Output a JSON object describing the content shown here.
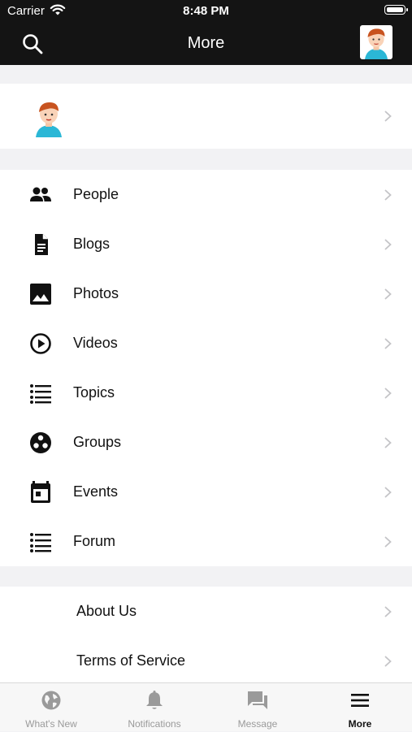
{
  "status_bar": {
    "carrier": "Carrier",
    "time": "8:48 PM"
  },
  "header": {
    "title": "More"
  },
  "menu": [
    {
      "label": "People",
      "icon": "people-icon"
    },
    {
      "label": "Blogs",
      "icon": "document-icon"
    },
    {
      "label": "Photos",
      "icon": "image-icon"
    },
    {
      "label": "Videos",
      "icon": "play-circle-icon"
    },
    {
      "label": "Topics",
      "icon": "list-icon"
    },
    {
      "label": "Groups",
      "icon": "group-circle-icon"
    },
    {
      "label": "Events",
      "icon": "calendar-icon"
    },
    {
      "label": "Forum",
      "icon": "list-icon"
    }
  ],
  "footer_links": [
    {
      "label": "About Us"
    },
    {
      "label": "Terms of Service"
    }
  ],
  "tabs": [
    {
      "label": "What's New",
      "icon": "globe-icon",
      "active": false
    },
    {
      "label": "Notifications",
      "icon": "bell-icon",
      "active": false
    },
    {
      "label": "Message",
      "icon": "chat-icon",
      "active": false
    },
    {
      "label": "More",
      "icon": "menu-icon",
      "active": true
    }
  ],
  "colors": {
    "header_bg": "#141414",
    "separator_bg": "#f2f2f4",
    "inactive_tab": "#9a9a9a",
    "chevron": "#c4c4c7"
  }
}
